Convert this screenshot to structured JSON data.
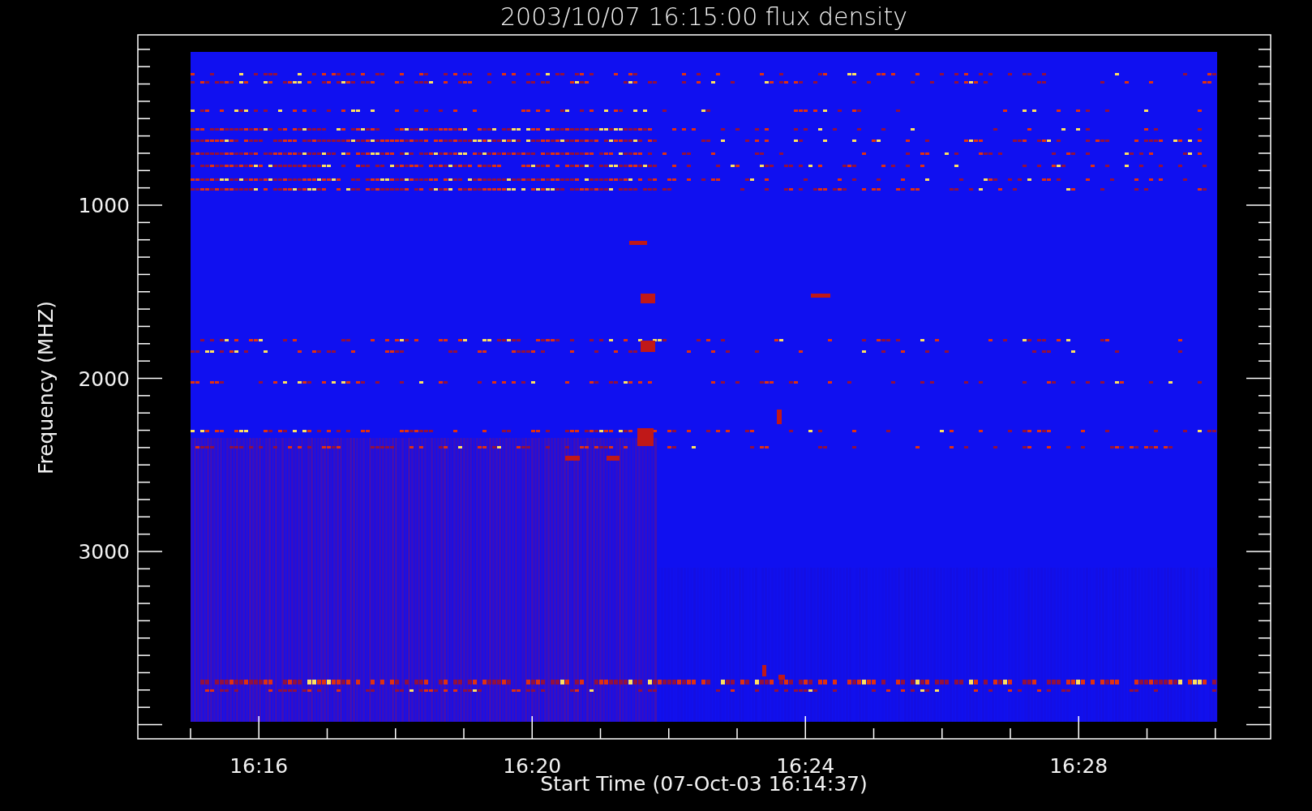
{
  "title": "2003/10/07 16:15:00 flux density",
  "ylabel": "Frequency (MHZ)",
  "xlabel": "Start Time (07-Oct-03 16:14:37)",
  "yticks": [
    "1000",
    "2000",
    "3000"
  ],
  "xticks": [
    "16:16",
    "16:20",
    "16:24",
    "16:28"
  ]
}
